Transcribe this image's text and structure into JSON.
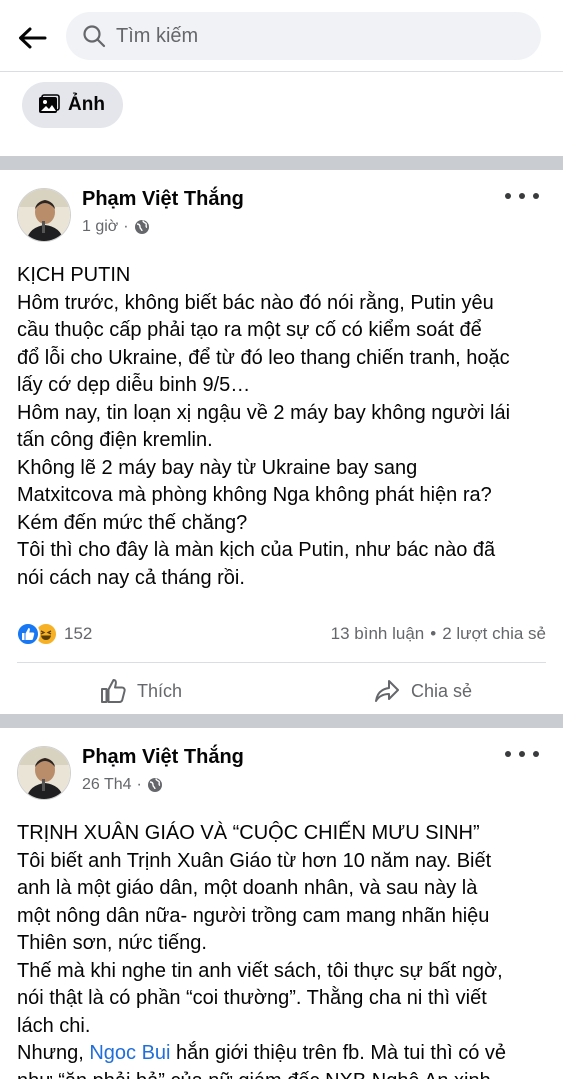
{
  "search": {
    "placeholder": "Tìm kiếm"
  },
  "filters": {
    "photo_label": "Ảnh"
  },
  "posts": [
    {
      "author": "Phạm Việt Thắng",
      "time": "1 giờ",
      "privacy_icon": "globe-icon",
      "lines": [
        "KỊCH PUTIN",
        "Hôm trước, không biết bác nào đó nói rằng, Putin yêu",
        "cầu thuộc cấp phải tạo ra một sự cố có kiểm soát để",
        "đổ lỗi cho Ukraine, để từ đó leo thang chiến tranh, hoặc",
        "lấy cớ dẹp diễu binh 9/5…",
        "Hôm nay, tin loạn xị ngậu về 2 máy bay không người lái",
        "tấn công điện kremlin.",
        "Không lẽ 2 máy bay này từ Ukraine bay sang",
        "Matxitcova mà phòng không Nga không phát hiện ra?",
        "Kém đến mức thế chăng?",
        "Tôi thì cho đây là màn kịch của Putin, như bác nào đã",
        "nói cách nay cả tháng rồi."
      ],
      "reaction_count": "152",
      "comments": "13 bình luận",
      "separator": "•",
      "shares": "2 lượt chia sẻ",
      "like_label": "Thích",
      "share_label": "Chia sẻ"
    },
    {
      "author": "Phạm Việt Thắng",
      "time": "26 Th4",
      "privacy_icon": "globe-icon",
      "lines": [
        "TRỊNH XUÂN GIÁO VÀ “CUỘC CHIẾN MƯU SINH”",
        "Tôi biết anh Trịnh Xuân Giáo từ hơn 10 năm nay. Biết",
        "anh là một giáo dân, một doanh nhân, và sau này là",
        "một nông dân nữa- người trồng cam mang nhãn hiệu",
        "Thiên sơn, nức tiếng.",
        "Thế mà khi nghe tin anh viết sách, tôi thực sự bất ngờ,",
        "nói thật là có phần “coi thường”. Thằng cha ni thì viết",
        "lách chi."
      ],
      "mention_line": {
        "before": "Nhưng, ",
        "mention": "Ngoc Bui",
        "after": " hắn giới thiệu trên fb. Mà tui thì có vẻ"
      },
      "last_line": "như “ăn phải bả” của nữ giám đốc NXB Nghệ An xinh"
    }
  ],
  "colors": {
    "accent": "#1877f2",
    "link": "#216fdb",
    "muted": "#65676b",
    "divider": "#c9ccd1"
  }
}
